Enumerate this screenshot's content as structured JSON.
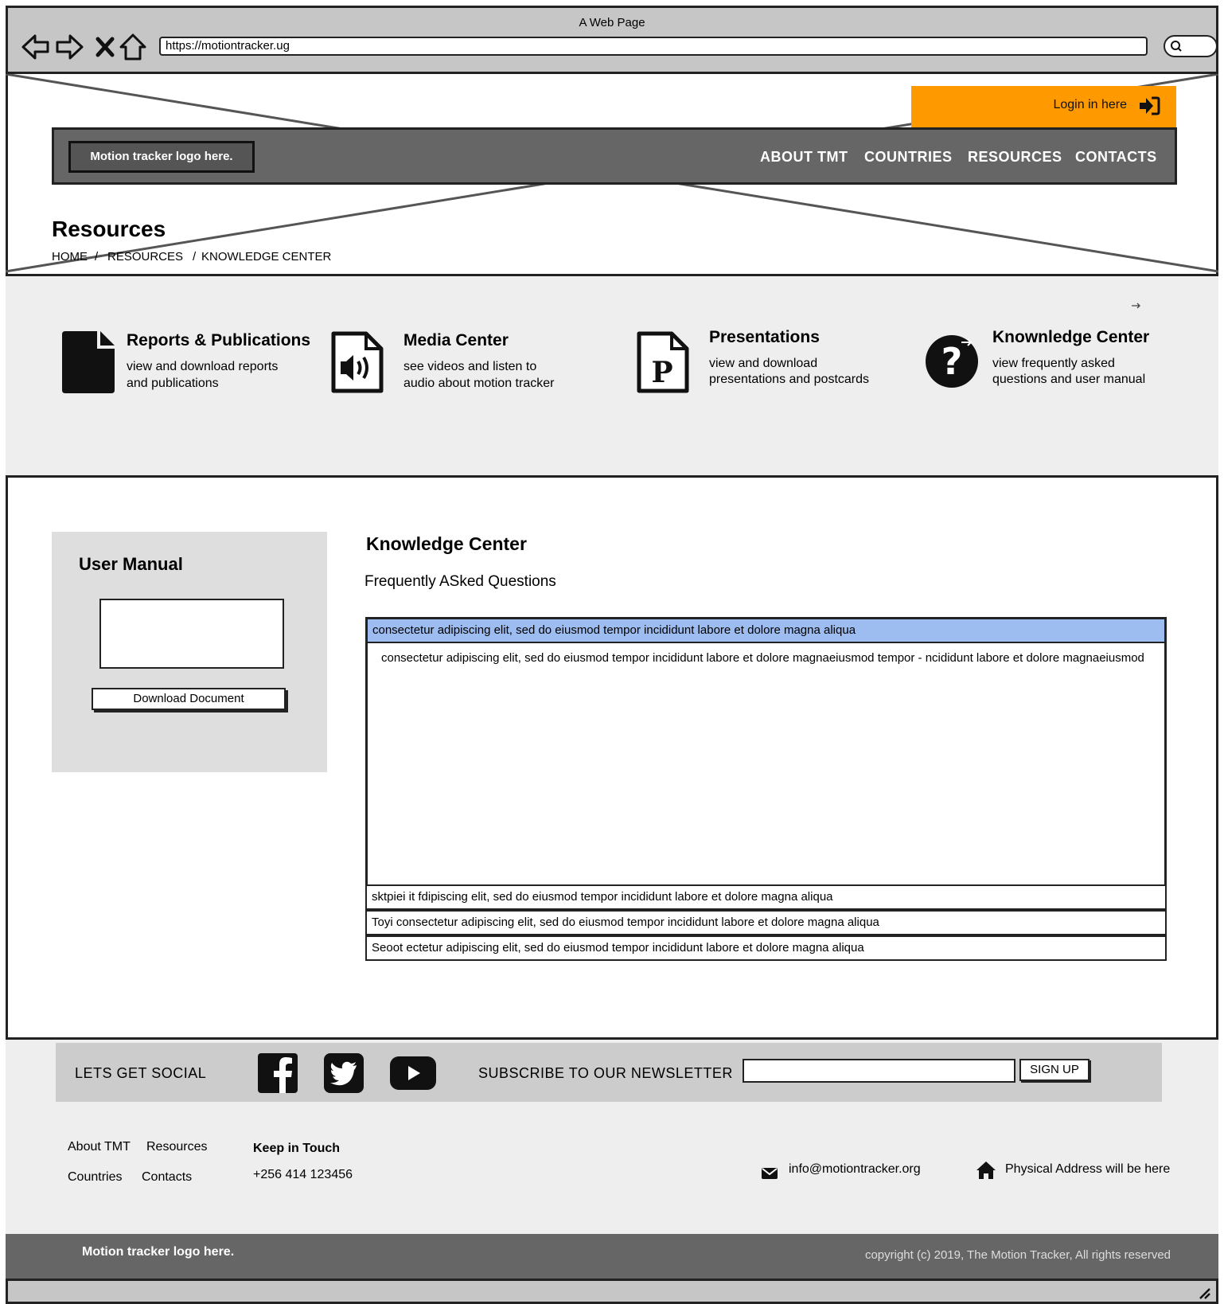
{
  "browser": {
    "window_title": "A Web Page",
    "url": "https://motiontracker.ug"
  },
  "header": {
    "login_label": "Login in here",
    "logo_text": "Motion tracker logo here.",
    "nav": [
      "ABOUT TMT",
      "COUNTRIES",
      "RESOURCES",
      "CONTACTS"
    ],
    "page_title": "Resources",
    "breadcrumb": [
      "HOME",
      "RESOURCES",
      "KNOWLEDGE CENTER"
    ]
  },
  "resources": [
    {
      "title": "Reports & Publications",
      "desc1": "view and download reports",
      "desc2": "and publications",
      "icon": "document-icon"
    },
    {
      "title": "Media Center",
      "desc1": "see videos and listen to",
      "desc2": "audio about motion tracker",
      "icon": "audio-file-icon"
    },
    {
      "title": "Presentations",
      "desc1": "view and download",
      "desc2": "presentations and postcards",
      "icon": "powerpoint-file-icon"
    },
    {
      "title": "Knownledge Center",
      "desc1": "view frequently asked",
      "desc2": "questions and user manual",
      "icon": "question-circle-icon"
    }
  ],
  "sidebar": {
    "title": "User Manual",
    "download_label": "Download Document"
  },
  "knowledge": {
    "title": "Knowledge Center",
    "subtitle": "Frequently ASked Questions",
    "faq_open_question": "consectetur adipiscing elit, sed do eiusmod tempor incididunt labore et dolore magna aliqua",
    "faq_open_answer": "consectetur adipiscing elit, sed do eiusmod tempor incididunt labore et dolore magnaeiusmod tempor - ncididunt labore et dolore magnaeiusmod",
    "faq_rows": [
      "sktpiei it fdipiscing elit, sed do eiusmod tempor incididunt labore et dolore magna aliqua",
      "Toyi consectetur adipiscing elit, sed do eiusmod tempor incididunt labore et dolore magna aliqua",
      "Seoot ectetur adipiscing elit, sed do eiusmod tempor incididunt labore et dolore magna aliqua"
    ]
  },
  "footer": {
    "social_label": "LETS GET SOCIAL",
    "subscribe_label": "SUBSCRIBE TO OUR NEWSLETTER",
    "signup_label": "SIGN UP",
    "links": {
      "about": "About TMT",
      "resources": "Resources",
      "countries": "Countries",
      "contacts": "Contacts"
    },
    "keep_in_touch": "Keep in Touch",
    "phone": "+256 414 123456",
    "email": "info@motiontracker.org",
    "address": "Physical Address will be here",
    "logo_text": "Motion tracker logo here.",
    "copyright": "copyright (c) 2019, The Motion Tracker, All rights reserved"
  },
  "colors": {
    "login_orange": "#ff9900",
    "nav_gray": "#666666",
    "faq_highlight": "#9dbcf0"
  }
}
